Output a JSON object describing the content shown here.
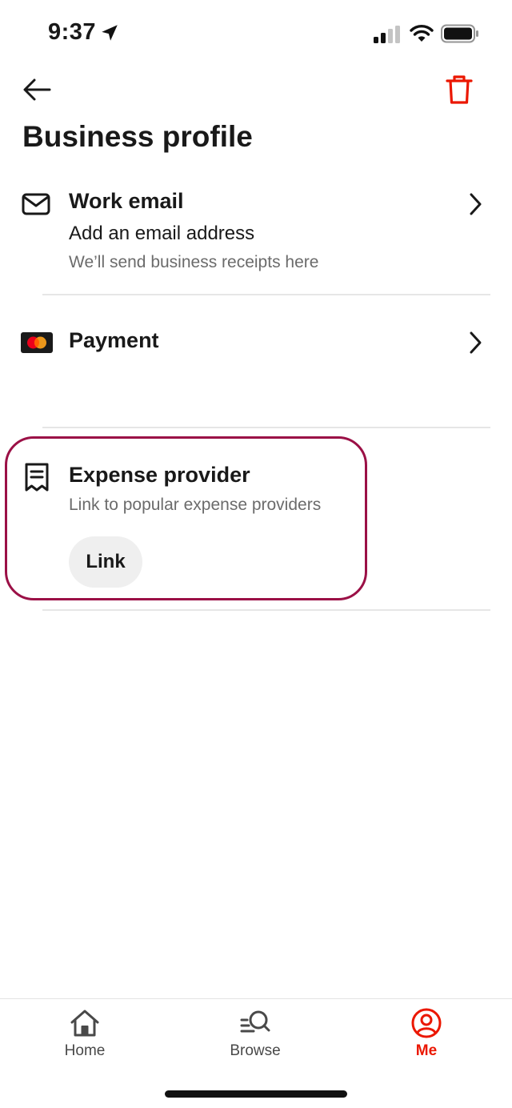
{
  "status_bar": {
    "time": "9:37"
  },
  "header": {
    "title": "Business profile"
  },
  "rows": {
    "work_email": {
      "title": "Work email",
      "value": "Add an email address",
      "subtitle": "We’ll send business receipts here"
    },
    "payment": {
      "title": "Payment"
    },
    "expense_provider": {
      "title": "Expense provider",
      "subtitle": "Link to popular expense providers",
      "button_label": "Link"
    }
  },
  "bottom_nav": {
    "items": [
      {
        "label": "Home",
        "icon": "home-icon",
        "active": false
      },
      {
        "label": "Browse",
        "icon": "browse-search-icon",
        "active": false
      },
      {
        "label": "Me",
        "icon": "account-icon",
        "active": true
      }
    ]
  },
  "colors": {
    "accent": "#eb1700",
    "highlight": "#9b1046",
    "text_primary": "#191919",
    "text_secondary": "#6b6b6b",
    "button_bg": "#efefef"
  }
}
